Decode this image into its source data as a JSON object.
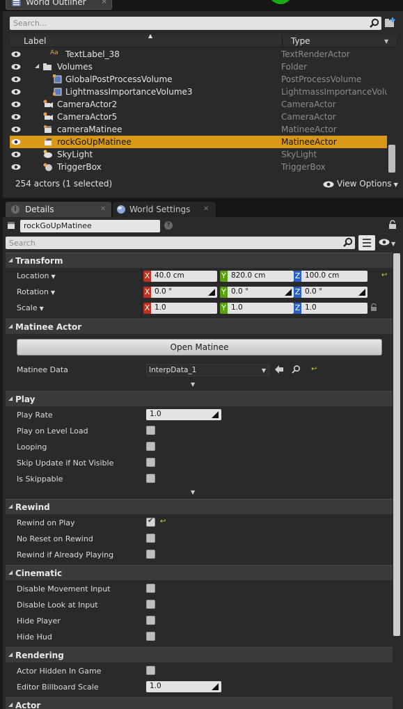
{
  "outliner": {
    "tab_title": "World Outliner",
    "search_placeholder": "Search...",
    "col_label": "Label",
    "col_type": "Type",
    "rows": [
      {
        "label": "TextLabel_38",
        "type": "TextRenderActor",
        "icon": "text-render-icon"
      },
      {
        "label": "Volumes",
        "type": "Folder",
        "icon": "folder-icon"
      },
      {
        "label": "GlobalPostProcessVolume",
        "type": "PostProcessVolume",
        "icon": "volume-icon"
      },
      {
        "label": "LightmassImportanceVolume3",
        "type": "LightmassImportanceVolum",
        "icon": "volume-icon"
      },
      {
        "label": "CameraActor2",
        "type": "CameraActor",
        "icon": "camera-icon"
      },
      {
        "label": "CameraActor5",
        "type": "CameraActor",
        "icon": "camera-icon"
      },
      {
        "label": "cameraMatinee",
        "type": "MatineeActor",
        "icon": "clapper-icon"
      },
      {
        "label": "rockGoUpMatinee",
        "type": "MatineeActor",
        "icon": "clapper-icon",
        "selected": true
      },
      {
        "label": "SkyLight",
        "type": "SkyLight",
        "icon": "skylight-icon"
      },
      {
        "label": "TriggerBox",
        "type": "TriggerBox",
        "icon": "triggerbox-icon"
      }
    ],
    "status": "254 actors (1 selected)",
    "view_options": "View Options"
  },
  "details": {
    "tab_details": "Details",
    "tab_world": "World Settings",
    "actor_name": "rockGoUpMatinee",
    "search_placeholder": "Search",
    "transform": {
      "title": "Transform",
      "location_label": "Location",
      "rotation_label": "Rotation",
      "scale_label": "Scale",
      "location": {
        "x": "40.0 cm",
        "y": "820.0 cm",
        "z": "100.0 cm"
      },
      "rotation": {
        "x": "0.0 °",
        "y": "0.0 °",
        "z": "0.0 °"
      },
      "scale": {
        "x": "1.0",
        "y": "1.0",
        "z": "1.0"
      }
    },
    "matinee": {
      "title": "Matinee Actor",
      "open_button": "Open Matinee",
      "data_label": "Matinee Data",
      "data_value": "InterpData_1"
    },
    "play": {
      "title": "Play",
      "play_rate_label": "Play Rate",
      "play_rate_value": "1.0",
      "play_on_level_load": "Play on Level Load",
      "looping": "Looping",
      "skip_update": "Skip Update if Not Visible",
      "is_skippable": "Is Skippable"
    },
    "rewind": {
      "title": "Rewind",
      "rewind_on_play": "Rewind on Play",
      "no_reset": "No Reset on Rewind",
      "rewind_if_playing": "Rewind if Already Playing"
    },
    "cinematic": {
      "title": "Cinematic",
      "disable_movement": "Disable Movement Input",
      "disable_look": "Disable Look at Input",
      "hide_player": "Hide Player",
      "hide_hud": "Hide Hud"
    },
    "rendering": {
      "title": "Rendering",
      "actor_hidden": "Actor Hidden In Game",
      "billboard_label": "Editor Billboard Scale",
      "billboard_value": "1.0"
    },
    "actor": {
      "title": "Actor"
    }
  },
  "colors": {
    "selection": "#d99818",
    "axis_x": "#c03020",
    "axis_y": "#5aa010",
    "axis_z": "#2a60c8"
  }
}
